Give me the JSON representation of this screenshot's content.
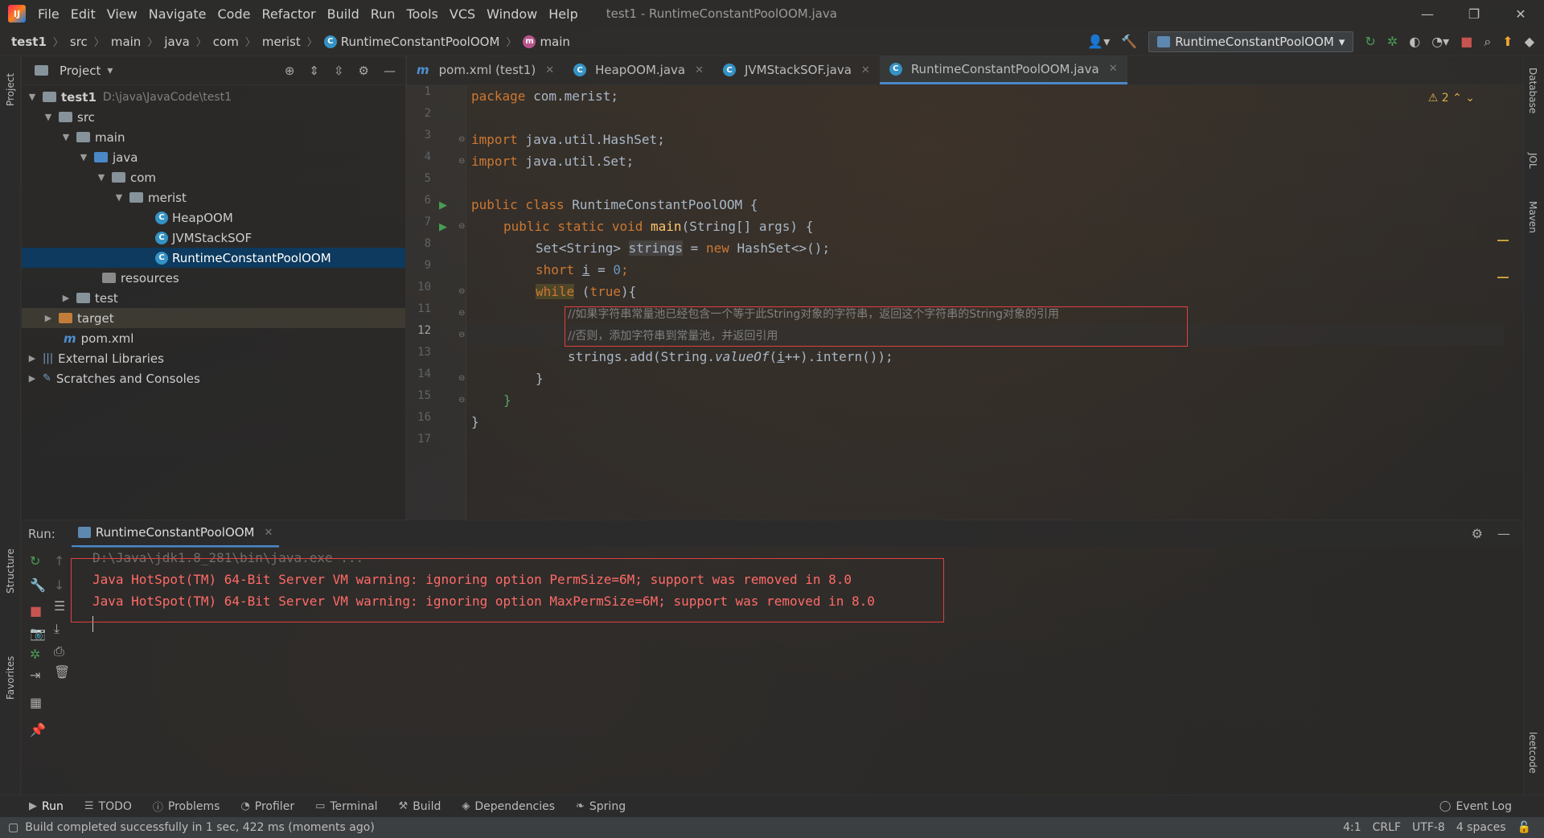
{
  "menubar": {
    "logo": "IJ",
    "items": [
      "File",
      "Edit",
      "View",
      "Navigate",
      "Code",
      "Refactor",
      "Build",
      "Run",
      "Tools",
      "VCS",
      "Window",
      "Help"
    ],
    "title": "test1 - RuntimeConstantPoolOOM.java",
    "controls": [
      "—",
      "❐",
      "✕"
    ]
  },
  "navbar": {
    "crumbs": [
      "test1",
      "src",
      "main",
      "java",
      "com",
      "merist",
      "RuntimeConstantPoolOOM",
      "main"
    ],
    "run_config": "RuntimeConstantPoolOOM"
  },
  "left_stripe": {
    "project": "Project",
    "structure": "Structure",
    "favorites": "Favorites"
  },
  "right_stripe": {
    "database": "Database",
    "jol": "JOL",
    "maven": "Maven",
    "leetcode": "leetcode"
  },
  "project_panel": {
    "title": "Project",
    "tree": [
      {
        "label": "test1",
        "hint": "D:\\java\\JavaCode\\test1"
      },
      {
        "label": "src"
      },
      {
        "label": "main"
      },
      {
        "label": "java"
      },
      {
        "label": "com"
      },
      {
        "label": "merist"
      },
      {
        "label": "HeapOOM"
      },
      {
        "label": "JVMStackSOF"
      },
      {
        "label": "RuntimeConstantPoolOOM"
      },
      {
        "label": "resources"
      },
      {
        "label": "test"
      },
      {
        "label": "target"
      },
      {
        "label": "pom.xml"
      },
      {
        "label": "External Libraries"
      },
      {
        "label": "Scratches and Consoles"
      }
    ]
  },
  "editor": {
    "tabs": [
      {
        "label": "pom.xml (test1)",
        "icon": "m"
      },
      {
        "label": "HeapOOM.java",
        "icon": "C"
      },
      {
        "label": "JVMStackSOF.java",
        "icon": "C"
      },
      {
        "label": "RuntimeConstantPoolOOM.java",
        "icon": "C"
      }
    ],
    "warning_count": "2",
    "line_numbers": [
      "1",
      "2",
      "3",
      "4",
      "5",
      "6",
      "7",
      "8",
      "9",
      "10",
      "11",
      "12",
      "13",
      "14",
      "15",
      "16",
      "17"
    ],
    "code": {
      "l1_kw": "package",
      "l1_rest": " com.merist;",
      "l3_kw": "import",
      "l3_rest": " java.util.HashSet;",
      "l4_kw": "import",
      "l4_rest": " java.util.Set;",
      "l6_kw": "public class",
      "l6_rest": " RuntimeConstantPoolOOM {",
      "l7_kw": "public static void",
      "l7_meth": "main",
      "l7_rest": "(String[] args) {",
      "l8_type": "Set<String> ",
      "l8_var": "strings",
      "l8_eq": " = ",
      "l8_new": "new",
      "l8_rest": " HashSet<>();",
      "l9_kw": "short",
      "l9_var": "i",
      "l9_eq": " = ",
      "l9_num": "0",
      "l9_semi": ";",
      "l10_kw": "while",
      "l10_paren": " (",
      "l10_true": "true",
      "l10_rest": "){",
      "l11_comment": "//如果字符串常量池已经包含一个等于此String对象的字符串，返回这个字符串的String对象的引用",
      "l12_comment": "//否则，添加字符串到常量池，并返回引用",
      "l13_a": "strings.add(String.",
      "l13_meth": "valueOf",
      "l13_b": "(",
      "l13_var": "i",
      "l13_c": "++).intern());",
      "l14": "}",
      "l15": "}",
      "l16": "}"
    }
  },
  "run_window": {
    "label": "Run:",
    "tab": "RuntimeConstantPoolOOM",
    "lines": [
      "D:\\Java\\jdk1.8_281\\bin\\java.exe ...",
      "Java HotSpot(TM) 64-Bit Server VM warning: ignoring option PermSize=6M; support was removed in 8.0",
      "Java HotSpot(TM) 64-Bit Server VM warning: ignoring option MaxPermSize=6M; support was removed in 8.0"
    ]
  },
  "bottom_tools": [
    "Run",
    "TODO",
    "Problems",
    "Profiler",
    "Terminal",
    "Build",
    "Dependencies",
    "Spring"
  ],
  "event_log": "Event Log",
  "status": {
    "message": "Build completed successfully in 1 sec, 422 ms (moments ago)",
    "position": "4:1",
    "line_sep": "CRLF",
    "encoding": "UTF-8",
    "indent": "4 spaces"
  },
  "colors": {
    "accent": "#4a88c7",
    "error_text": "#ff6b68",
    "annotation_box": "#e04040",
    "keyword": "#cc7832",
    "comment": "#808080"
  }
}
